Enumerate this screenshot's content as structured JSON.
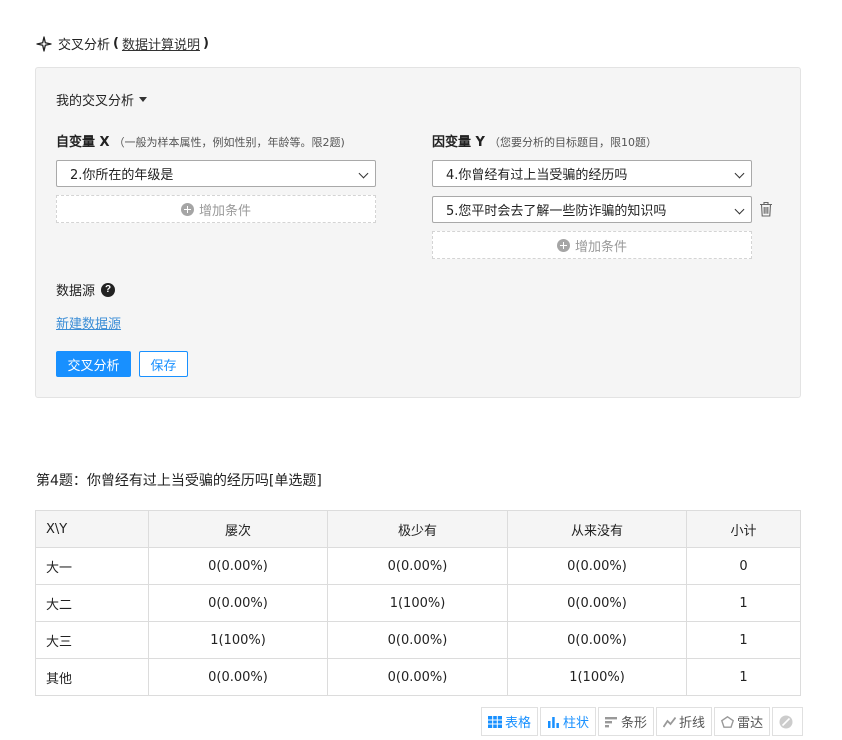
{
  "header": {
    "title": "交叉分析",
    "paren_open": "(",
    "link": "数据计算说明",
    "paren_close": ")"
  },
  "panel": {
    "mine_label": "我的交叉分析",
    "x": {
      "label": "自变量 X",
      "hint": "（一般为样本属性，例如性别，年龄等。限2题)",
      "selected": "2.你所在的年级是",
      "add_label": "增加条件"
    },
    "y": {
      "label": "因变量 Y",
      "hint": "（您要分析的目标题目，限10题）",
      "selects": [
        "4.你曾经有过上当受骗的经历吗",
        "5.您平时会去了解一些防诈骗的知识吗"
      ],
      "add_label": "增加条件"
    },
    "datasource": {
      "title": "数据源",
      "help": "?",
      "new_link": "新建数据源"
    },
    "buttons": {
      "analyze": "交叉分析",
      "save": "保存"
    }
  },
  "question": {
    "title": "第4题：你曾经有过上当受骗的经历吗[单选题]"
  },
  "table": {
    "headers": [
      "X\\Y",
      "屡次",
      "极少有",
      "从来没有",
      "小计"
    ],
    "rows": [
      [
        "大一",
        "0(0.00%)",
        "0(0.00%)",
        "0(0.00%)",
        "0"
      ],
      [
        "大二",
        "0(0.00%)",
        "1(100%)",
        "0(0.00%)",
        "1"
      ],
      [
        "大三",
        "1(100%)",
        "0(0.00%)",
        "0(0.00%)",
        "1"
      ],
      [
        "其他",
        "0(0.00%)",
        "0(0.00%)",
        "1(100%)",
        "1"
      ]
    ]
  },
  "toolbar": {
    "items": [
      "表格",
      "柱状",
      "条形",
      "折线",
      "雷达"
    ],
    "active_color": "#1890ff"
  }
}
